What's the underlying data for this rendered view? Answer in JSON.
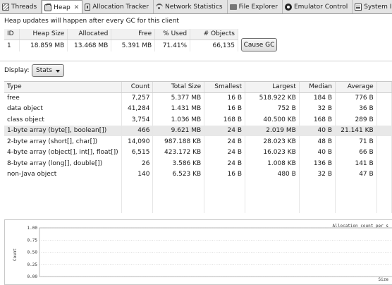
{
  "tabs": [
    {
      "label": "Threads",
      "icon": "threads-icon",
      "active": false,
      "closable": false
    },
    {
      "label": "Heap",
      "icon": "heap-icon",
      "active": true,
      "closable": true
    },
    {
      "label": "Allocation Tracker",
      "icon": "allocation-tracker-icon",
      "active": false,
      "closable": false
    },
    {
      "label": "Network Statistics",
      "icon": "network-icon",
      "active": false,
      "closable": false
    },
    {
      "label": "File Explorer",
      "icon": "file-explorer-icon",
      "active": false,
      "closable": false
    },
    {
      "label": "Emulator Control",
      "icon": "emulator-control-icon",
      "active": false,
      "closable": false
    },
    {
      "label": "System Info",
      "icon": "system-info-icon",
      "active": false,
      "closable": false
    }
  ],
  "message": "Heap updates will happen after every GC for this client",
  "summary": {
    "headers": [
      "ID",
      "Heap Size",
      "Allocated",
      "Free",
      "% Used",
      "# Objects"
    ],
    "row": [
      "1",
      "18.859 MB",
      "13.468 MB",
      "5.391 MB",
      "71.41%",
      "66,135"
    ]
  },
  "cause_gc_label": "Cause GC",
  "display": {
    "label": "Display:",
    "selected": "Stats"
  },
  "stats": {
    "headers": [
      "Type",
      "Count",
      "Total Size",
      "Smallest",
      "Largest",
      "Median",
      "Average"
    ],
    "rows": [
      [
        "free",
        "7,257",
        "5.377 MB",
        "16 B",
        "518.922 KB",
        "184 B",
        "776 B"
      ],
      [
        "data object",
        "41,284",
        "1.431 MB",
        "16 B",
        "752 B",
        "32 B",
        "36 B"
      ],
      [
        "class object",
        "3,754",
        "1.036 MB",
        "168 B",
        "40.500 KB",
        "168 B",
        "289 B"
      ],
      [
        "1-byte array (byte[], boolean[])",
        "466",
        "9.621 MB",
        "24 B",
        "2.019 MB",
        "40 B",
        "21.141 KB"
      ],
      [
        "2-byte array (short[], char[])",
        "14,090",
        "987.188 KB",
        "24 B",
        "28.023 KB",
        "48 B",
        "71 B"
      ],
      [
        "4-byte array (object[], int[], float[])",
        "6,515",
        "423.172 KB",
        "24 B",
        "16.023 KB",
        "40 B",
        "66 B"
      ],
      [
        "8-byte array (long[], double[])",
        "26",
        "3.586 KB",
        "24 B",
        "1.008 KB",
        "136 B",
        "141 B"
      ],
      [
        "non-Java object",
        "140",
        "6.523 KB",
        "16 B",
        "480 B",
        "32 B",
        "47 B"
      ]
    ],
    "selected_row": 3,
    "empty_rows": 3
  },
  "chart": {
    "title": "Allocation count per s",
    "y_label": "Count",
    "x_label": "Size",
    "y_ticks": [
      "1.00",
      "0.75",
      "0.50",
      "0.25",
      "0.00"
    ]
  }
}
